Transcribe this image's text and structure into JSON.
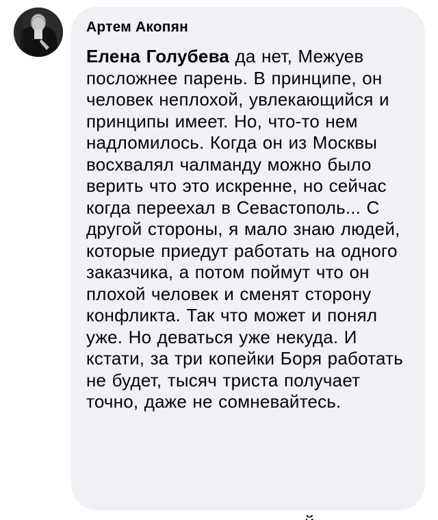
{
  "comment": {
    "author": "Артем Акопян",
    "mention": "Елена Голубева",
    "body": "да нет, Межуев посложнее парень. В принципе, он человек неплохой, увлекающийся и принципы имеет. Но, что-то нем надломилось. Когда он из Москвы восхвалял чалманду можно было верить что это искренне, но сейчас когда переехал в Севастополь... С другой стороны, я мало знаю людей, которые приедут работать на одного заказчика, а потом поймут что он плохой человек и сменят сторону конфликта. Так что может и понял уже. Но деваться уже некуда. И кстати, за три копейки Боря работать не будет, тысяч триста получает точно, даже не сомневайтесь."
  },
  "colors": {
    "bubble_background": "#eff1f4",
    "text": "#050505",
    "page_background": "#ffffff"
  }
}
